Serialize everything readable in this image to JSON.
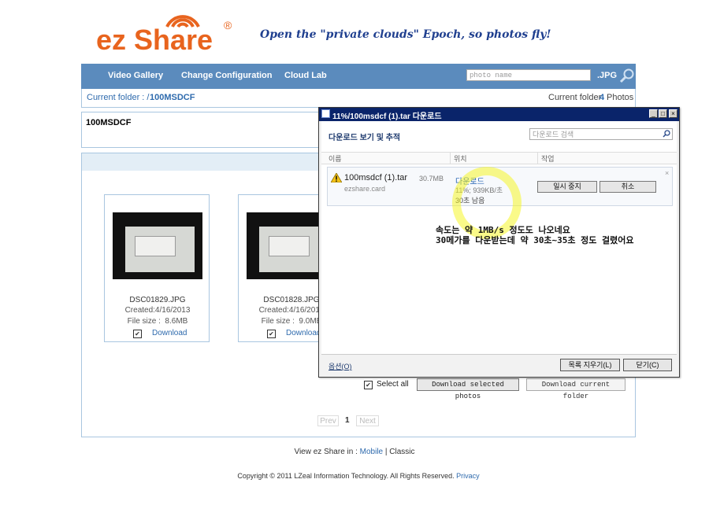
{
  "logo": {
    "text": "ez Share",
    "reg": "®"
  },
  "slogan": "Open the \"private clouds\" Epoch, so photos fly!",
  "nav": {
    "items": [
      {
        "label": "Video Gallery"
      },
      {
        "label": "Change Configuration"
      },
      {
        "label": "Cloud Lab"
      }
    ],
    "search_placeholder": "photo name",
    "search_ext": ".JPG"
  },
  "breadcrumb": {
    "prefix": "Current folder : /",
    "folder": "100MSDCF",
    "count_prefix": "Current folder",
    "count": "4",
    "count_suffix": "Photos"
  },
  "folder_title": "100MSDCF",
  "photos": [
    {
      "name": "DSC01829.JPG",
      "created": "Created:4/16/2013",
      "size": "File size :  8.6MB",
      "download": "Download",
      "checked": "✔"
    },
    {
      "name": "DSC01828.JPG",
      "created": "Created:4/16/2013",
      "size": "File size :  9.0MB",
      "download": "Download",
      "checked": "✔"
    }
  ],
  "actions": {
    "select_all": "Select all",
    "select_all_checked": "✔",
    "download_selected": "Download selected photos",
    "download_current": "Download current folder"
  },
  "pager": {
    "prev": "Prev",
    "current": "1",
    "next": "Next"
  },
  "footer": {
    "view_in": "View ez Share in :",
    "mobile": "Mobile",
    "sep": "|",
    "classic": "Classic",
    "copyright": "Copyright © 2011 LZeal Information Technology. All Rights Reserved.",
    "privacy": "Privacy"
  },
  "download_window": {
    "title": "11%/100msdcf (1).tar 다운로드",
    "heading": "다운로드 보기 및 추적",
    "search_placeholder": "다운로드 검색",
    "columns": {
      "name": "이름",
      "location": "위치",
      "action": "작업"
    },
    "item": {
      "file": "100msdcf (1).tar",
      "size": "30.7MB",
      "source": "ezshare.card",
      "location": "다운로드",
      "speed": "11%; 939KB/초",
      "remaining": "30초 남음",
      "pause": "일시 중지",
      "cancel": "취소",
      "close": "×"
    },
    "note_line1": "속도는 약 1MB/s 정도도 나오네요",
    "note_line2": "30메가를 다운받는데 약 30초~35초 정도 걸렸어요",
    "options": "옵션(O)",
    "clear_list": "목록 지우기(L)",
    "close_btn": "닫기(C)",
    "buttons": {
      "min": "_",
      "max": "□",
      "close": "×"
    }
  }
}
